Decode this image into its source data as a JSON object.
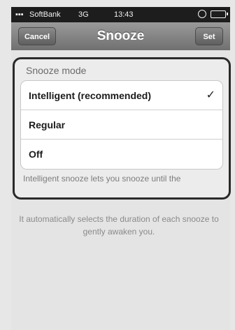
{
  "status_bar": {
    "carrier": "SoftBank",
    "network": "3G",
    "time": "13:43"
  },
  "nav": {
    "cancel_label": "Cancel",
    "title": "Snooze",
    "set_label": "Set"
  },
  "panel": {
    "section_header": "Snooze mode",
    "options": [
      {
        "label": "Intelligent (recommended)",
        "selected": true
      },
      {
        "label": "Regular",
        "selected": false
      },
      {
        "label": "Off",
        "selected": false
      }
    ],
    "check_mark": "✓",
    "footer_note": "Intelligent snooze lets you snooze until the"
  },
  "background": {
    "description": "It automatically selects the duration of each snooze to gently awaken you."
  }
}
